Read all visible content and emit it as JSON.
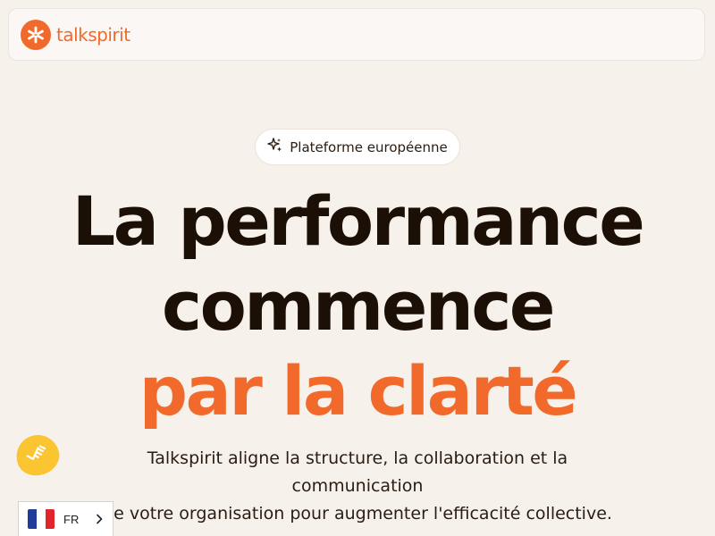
{
  "header": {
    "logo_text": "talkspirit"
  },
  "hero": {
    "badge_label": "Plateforme européenne",
    "headline_line1": "La performance",
    "headline_line2": "commence",
    "headline_line3": "par la clarté",
    "subtitle_line1": "Talkspirit aligne la structure, la collaboration et la communication",
    "subtitle_line2": "de votre organisation pour augmenter l'efficacité collective."
  },
  "language_selector": {
    "code": "FR"
  },
  "colors": {
    "brand_orange": "#f26a2b",
    "background": "#f7f1ec",
    "text_dark": "#1c1006",
    "bubble_yellow": "#fbc531",
    "flag_blue": "#1f3c9a",
    "flag_white": "#ffffff",
    "flag_red": "#e0262c"
  },
  "icons": {
    "logo": "asterisk-logo-icon",
    "badge": "sparkles-icon",
    "bubble": "handshake-icon",
    "lang_flag": "france-flag-icon",
    "lang_chevron": "chevron-right-icon"
  }
}
